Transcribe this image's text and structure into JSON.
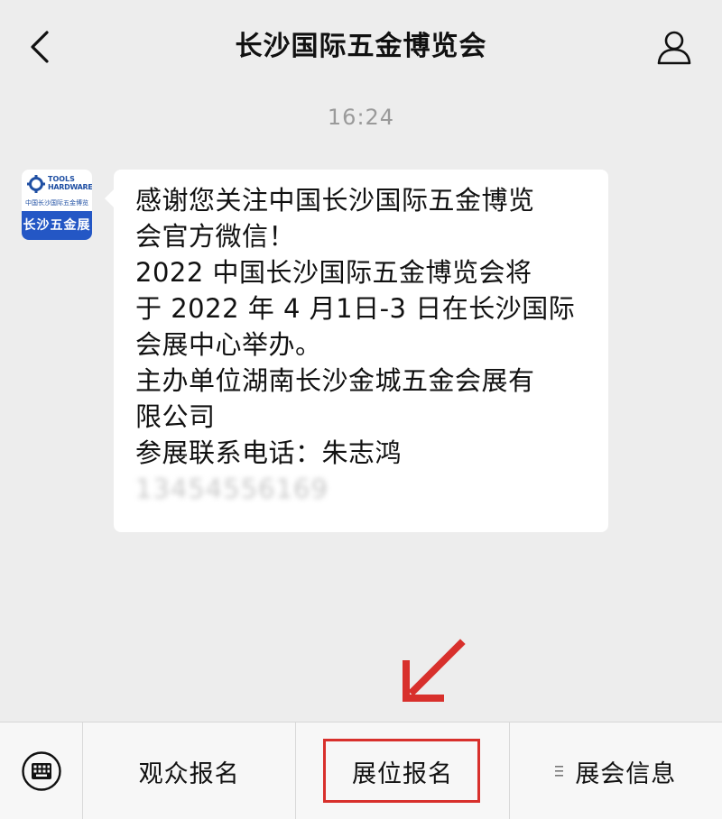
{
  "header": {
    "title": "长沙国际五金博览会",
    "back_icon": "chevron-left-icon",
    "profile_icon": "person-icon"
  },
  "chat": {
    "timestamp": "16:24",
    "avatar": {
      "logo_line1": "TOOLS",
      "logo_line2": "HARDWARE",
      "logo_sub": "中国长沙国际五金博览会",
      "label": "长沙五金展",
      "brand_color": "#2457c5"
    },
    "message_lines": [
      "感谢您关注中国长沙国际五金博览",
      "会官方微信！",
      "2022 中国长沙国际五金博览会将",
      "于 2022 年 4 月1日-3 日在长沙国际",
      "会展中心举办。",
      "主办单位湖南长沙金城五金会展有",
      "限公司",
      "参展联系电话：朱志鸿"
    ],
    "phone_blurred": "13454556169"
  },
  "annotation": {
    "arrow_color": "#d8302c"
  },
  "bottom_menu": {
    "keyboard_icon": "keyboard-icon",
    "items": [
      {
        "label": "观众报名"
      },
      {
        "label": "展位报名",
        "highlighted": true
      },
      {
        "label": "展会信息",
        "icon": "menu-lines-icon"
      }
    ]
  }
}
